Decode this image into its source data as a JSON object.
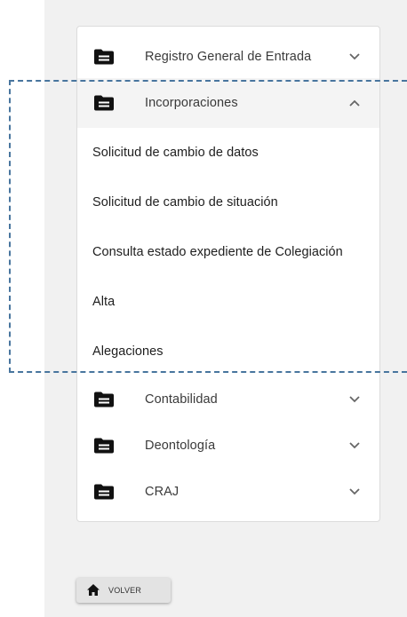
{
  "menu": {
    "sections": [
      {
        "label": "Registro General de Entrada",
        "icon": "folder-icon",
        "expanded": false
      },
      {
        "label": "Incorporaciones",
        "icon": "folder-icon",
        "expanded": true
      },
      {
        "label": "Contabilidad",
        "icon": "folder-icon",
        "expanded": false
      },
      {
        "label": "Deontología",
        "icon": "folder-icon",
        "expanded": false
      },
      {
        "label": "CRAJ",
        "icon": "folder-icon",
        "expanded": false
      }
    ],
    "incorporaciones_items": [
      "Solicitud de cambio de datos",
      "Solicitud de cambio de situación",
      "Consulta estado expediente de Colegiación",
      "Alta",
      "Alegaciones"
    ]
  },
  "back_button": {
    "label": "VOLVER",
    "icon": "home-icon"
  },
  "colors": {
    "highlight_dash": "#48759e",
    "panel_background": "#f1f1f1",
    "icon": "#111111",
    "text": "#3a3a3a"
  }
}
